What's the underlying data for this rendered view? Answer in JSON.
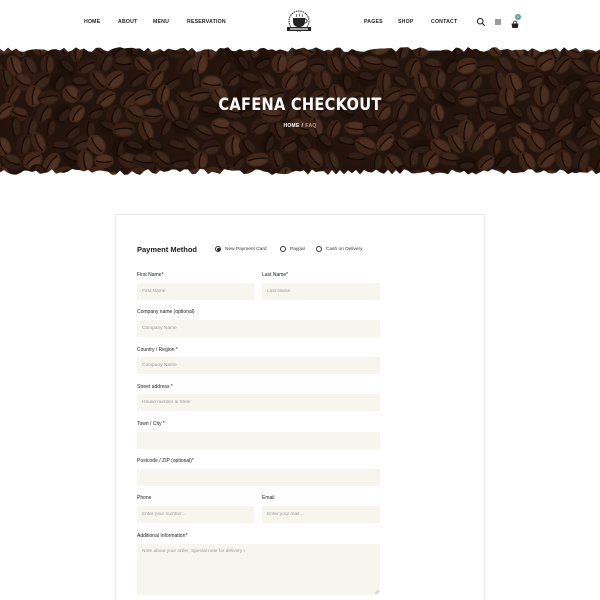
{
  "nav": {
    "left": [
      "HOME",
      "ABOUT",
      "MENU",
      "RESERVATION"
    ],
    "right": [
      "PAGES",
      "SHOP",
      "CONTACT"
    ]
  },
  "icons": {
    "search": "search-icon",
    "menu": "hamburger-icon",
    "cart": "cart-icon"
  },
  "cart": {
    "count": "0"
  },
  "hero": {
    "title": "CAFENA CHECKOUT",
    "crumb_home": "HOME",
    "crumb_sep": "/",
    "crumb_current": "FAQ"
  },
  "payment": {
    "title": "Payment Method",
    "options": [
      "New Payment Card",
      "Paypal",
      "Cash on Delivery"
    ],
    "selected": "New Payment Card"
  },
  "form": {
    "first_name": {
      "label": "First Name*",
      "placeholder": "First Name"
    },
    "last_name": {
      "label": "Last Name*",
      "placeholder": "Last Name"
    },
    "company": {
      "label": "Company name (optional)",
      "placeholder": "Company Name"
    },
    "country": {
      "label": "Country / Region *",
      "placeholder": "Company Name"
    },
    "street": {
      "label": "Street address *",
      "placeholder": "House number & Stete"
    },
    "town": {
      "label": "Town / City *",
      "placeholder": ""
    },
    "postcode": {
      "label": "Postcode / ZIP (optional)*",
      "placeholder": ""
    },
    "phone": {
      "label": "Phone",
      "placeholder": "Enter your number..."
    },
    "email": {
      "label": "Email",
      "placeholder": "Enter your mail..."
    },
    "additional": {
      "label": "Additional Information*",
      "placeholder": "Note about your order, Special note for delivery !"
    }
  },
  "colors": {
    "accent": "#c9a07a",
    "badge": "#5aa39a",
    "input_bg": "#f6f6ef",
    "hero_bg": "#2a1a12"
  }
}
